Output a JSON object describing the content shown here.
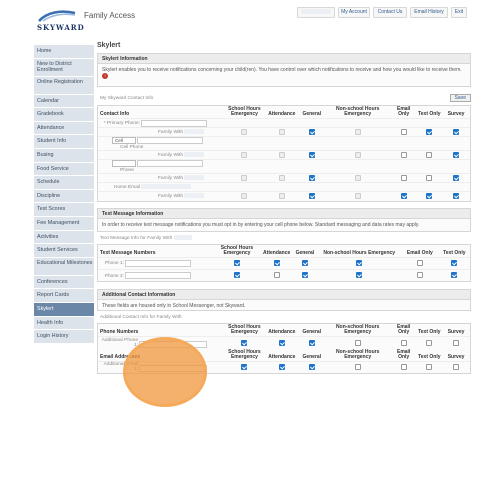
{
  "header": {
    "brand": "SKYWARD",
    "app_title": "Family Access",
    "nav": [
      "My Account",
      "Contact Us",
      "Email History",
      "Exit"
    ]
  },
  "sidebar": {
    "items": [
      "Home",
      "New to District Enrollment",
      "Online Registration",
      "Calendar",
      "Gradebook",
      "Attendance",
      "Student Info",
      "Busing",
      "Food Service",
      "Schedule",
      "Discipline",
      "Test Scores",
      "Fee Management",
      "Activities",
      "Student Services",
      "Educational Milestones",
      "Conferences",
      "Report Cards",
      "Skylert",
      "Health Info",
      "Login History"
    ],
    "active": "Skylert"
  },
  "page": {
    "title": "Skylert",
    "info_title": "Skylert Information",
    "info_text": "Skylert enables you to receive notifications concerning your child(ren). You have control over which notifications to receive and how you would like to receive them.",
    "contact_section_label": "My Skyward Contact Info",
    "save_label": "Save",
    "columns": [
      "School Hours Emergency",
      "Attendance",
      "General",
      "Non-school Hours Emergency",
      "Email Only",
      "Text Only",
      "Survey"
    ],
    "contact_header": "Contact Info",
    "contact_rows": [
      {
        "label": "* Primary Phone:",
        "sub": "Family With",
        "cells": [
          "d",
          "d",
          "on",
          "d",
          "off",
          "on",
          "on"
        ]
      },
      {
        "label": "Cell Phone",
        "sub": "Family With",
        "select": "Cell",
        "cells": [
          "d",
          "d",
          "on",
          "d",
          "off",
          "off",
          "on"
        ]
      },
      {
        "label": "Phone",
        "sub": "Family With",
        "select": "",
        "cells": [
          "d",
          "d",
          "on",
          "d",
          "off",
          "off",
          "on"
        ]
      },
      {
        "label": "Home Email",
        "sub": "Family With",
        "cells": [
          "d",
          "d",
          "on",
          "d",
          "on",
          "on",
          "on"
        ]
      }
    ],
    "text_title": "Text Message Information",
    "text_info": "In order to receive text message notifications you must opt in by entering your cell phone below. Standard messaging and data rates may apply.",
    "text_for_label": "Text Message Info for Family With",
    "text_header": "Text Message Numbers",
    "text_columns": [
      "School Hours Emergency",
      "Attendance",
      "General",
      "Non-school Hours Emergency",
      "Email Only",
      "Text Only"
    ],
    "text_rows": [
      {
        "label": "Phone 1:",
        "cells": [
          "on",
          "on",
          "on",
          "on",
          "off",
          "on"
        ]
      },
      {
        "label": "Phone 2:",
        "cells": [
          "on",
          "off",
          "on",
          "on",
          "off",
          "on"
        ]
      }
    ],
    "additional_title": "Additional Contact Information",
    "additional_info": "These fields are housed only in School Messenger, not Skyward.",
    "additional_for_label": "Additional Contact Info for Family With",
    "phone_header": "Phone Numbers",
    "email_header": "Email Addresses",
    "phone_row_label": "Additional Phone 1:",
    "email_row_label": "Additional Email 1:",
    "phone_cells": [
      "on",
      "on",
      "on",
      "off",
      "off",
      "off",
      "off"
    ],
    "email_cells": [
      "on",
      "on",
      "on",
      "off",
      "off",
      "off",
      "off"
    ]
  }
}
